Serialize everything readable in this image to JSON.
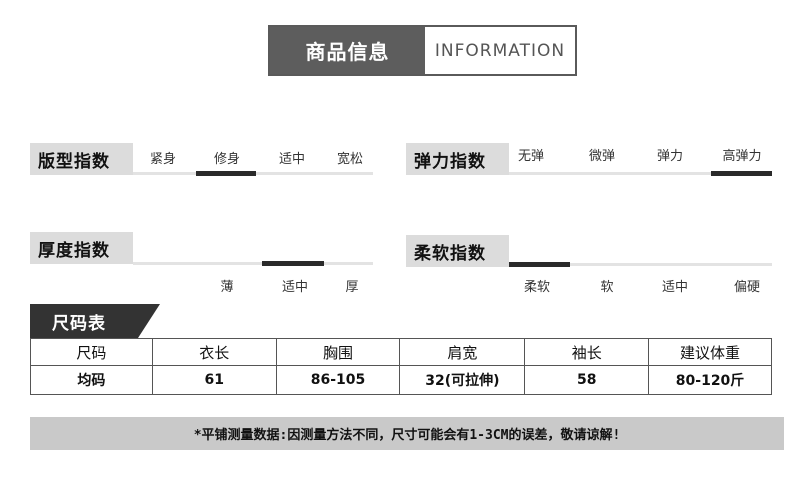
{
  "header": {
    "title_cn": "商品信息",
    "title_en": "INFORMATION"
  },
  "indices": {
    "fit": {
      "label": "版型指数",
      "options": [
        "紧身",
        "修身",
        "适中",
        "宽松"
      ],
      "selected": "修身"
    },
    "elastic": {
      "label": "弹力指数",
      "options": [
        "无弹",
        "微弹",
        "弹力",
        "高弹力"
      ],
      "selected": "高弹力"
    },
    "thickness": {
      "label": "厚度指数",
      "options": [
        "薄",
        "适中",
        "厚"
      ],
      "selected": "适中"
    },
    "softness": {
      "label": "柔软指数",
      "options": [
        "柔软",
        "软",
        "适中",
        "偏硬"
      ],
      "selected": "柔软"
    }
  },
  "size_table": {
    "title": "尺码表",
    "headers": [
      "尺码",
      "衣长",
      "胸围",
      "肩宽",
      "袖长",
      "建议体重"
    ],
    "rows": [
      [
        "均码",
        "61",
        "86-105",
        "32(可拉伸)",
        "58",
        "80-120斤"
      ]
    ]
  },
  "note": "*平铺测量数据:因测量方法不同，尺寸可能会有1-3CM的误差，敬请谅解!"
}
